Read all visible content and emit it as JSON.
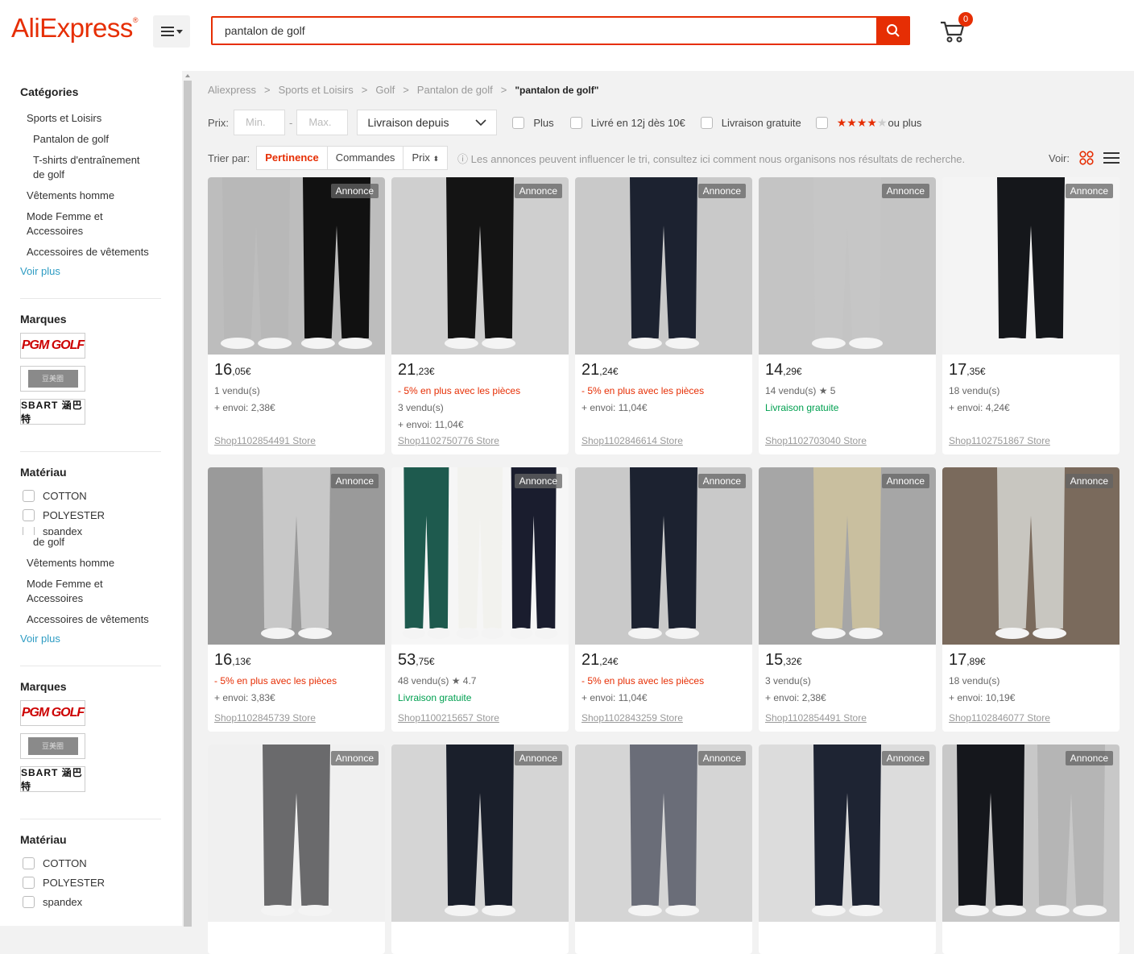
{
  "header": {
    "logo": "AliExpress",
    "logo_mark": "®",
    "search_value": "pantalon de golf",
    "cart_count": "0"
  },
  "sidebar": {
    "categories_title": "Catégories",
    "categories": [
      "Sports et Loisirs",
      "Pantalon de golf",
      "T-shirts d'entraînement de golf",
      "Vêtements homme",
      "Mode Femme et Accessoires",
      "Accessoires de vêtements"
    ],
    "categories_repeat": [
      "de golf",
      "Vêtements homme",
      "Mode Femme et Accessoires",
      "Accessoires de vêtements"
    ],
    "more": "Voir plus",
    "brands_title": "Marques",
    "brands": [
      "PGM GOLF",
      "豆美圈",
      "SBART 涵巴特"
    ],
    "material_title": "Matériau",
    "materials": [
      "COTTON",
      "POLYESTER",
      "spandex"
    ]
  },
  "breadcrumb": [
    "Aliexpress",
    "Sports et Loisirs",
    "Golf",
    "Pantalon de golf",
    "\"pantalon de golf\""
  ],
  "filters": {
    "price_label": "Prix:",
    "min_placeholder": "Min.",
    "max_placeholder": "Max.",
    "shipping_select": "Livraison depuis",
    "options": [
      "Plus",
      "Livré en 12j dès 10€",
      "Livraison gratuite",
      "ou plus"
    ],
    "rating_stars": 4
  },
  "sort": {
    "label": "Trier par:",
    "options": [
      "Pertinence",
      "Commandes",
      "Prix"
    ],
    "active": "Pertinence",
    "notice": "Les annonces peuvent influencer le tri, consultez ici comment nous organisons nos résultats de recherche.",
    "view_label": "Voir:"
  },
  "ad_label": "Annonce",
  "products": [
    {
      "price_int": "16",
      "price_dec": ",05€",
      "lines": [
        {
          "t": "1 vendu(s)",
          "c": ""
        },
        {
          "t": "+ envoi: 2,38€",
          "c": ""
        }
      ],
      "store": "Shop1102854491 Store",
      "tone": "#bdbdbd",
      "pants": [
        "#b8b8b8",
        "#111111"
      ]
    },
    {
      "price_int": "21",
      "price_dec": ",23€",
      "lines": [
        {
          "t": "- 5% en plus avec les pièces",
          "c": "red"
        },
        {
          "t": "3 vendu(s)",
          "c": ""
        },
        {
          "t": "+ envoi: 11,04€",
          "c": ""
        }
      ],
      "store": "Shop1102750776 Store",
      "tone": "#cfcfcf",
      "pants": [
        "#141414"
      ]
    },
    {
      "price_int": "21",
      "price_dec": ",24€",
      "lines": [
        {
          "t": "- 5% en plus avec les pièces",
          "c": "red"
        },
        {
          "t": "+ envoi: 11,04€",
          "c": ""
        }
      ],
      "store": "Shop1102846614 Store",
      "tone": "#c9c9c9",
      "pants": [
        "#1c2230"
      ]
    },
    {
      "price_int": "14",
      "price_dec": ",29€",
      "lines": [
        {
          "t": "14 vendu(s) ★ 5",
          "c": ""
        },
        {
          "t": "Livraison gratuite",
          "c": "green"
        }
      ],
      "store": "Shop1102703040 Store",
      "tone": "#c4c4c4",
      "pants": [
        "#c6c6c6"
      ]
    },
    {
      "price_int": "17",
      "price_dec": ",35€",
      "lines": [
        {
          "t": "18 vendu(s)",
          "c": ""
        },
        {
          "t": "+ envoi: 4,24€",
          "c": ""
        }
      ],
      "store": "Shop1102751867 Store",
      "tone": "#f4f4f4",
      "pants": [
        "#15171b"
      ]
    },
    {
      "price_int": "16",
      "price_dec": ",13€",
      "lines": [
        {
          "t": "- 5% en plus avec les pièces",
          "c": "red"
        },
        {
          "t": "+ envoi: 3,83€",
          "c": ""
        }
      ],
      "store": "Shop1102845739 Store",
      "tone": "#9a9a9a",
      "pants": [
        "#c8c8c8"
      ]
    },
    {
      "price_int": "53",
      "price_dec": ",75€",
      "lines": [
        {
          "t": "48 vendu(s) ★ 4.7",
          "c": ""
        },
        {
          "t": "Livraison gratuite",
          "c": "green"
        }
      ],
      "store": "Shop1100215657 Store",
      "tone": "#f6f6f6",
      "pants": [
        "#1e5a4e",
        "#f2f2ee",
        "#1a1d2e"
      ]
    },
    {
      "price_int": "21",
      "price_dec": ",24€",
      "lines": [
        {
          "t": "- 5% en plus avec les pièces",
          "c": "red"
        },
        {
          "t": "+ envoi: 11,04€",
          "c": ""
        }
      ],
      "store": "Shop1102843259 Store",
      "tone": "#c9c9c9",
      "pants": [
        "#1c2230"
      ]
    },
    {
      "price_int": "15",
      "price_dec": ",32€",
      "lines": [
        {
          "t": "3 vendu(s)",
          "c": ""
        },
        {
          "t": "+ envoi: 2,38€",
          "c": ""
        }
      ],
      "store": "Shop1102854491 Store",
      "tone": "#a6a6a6",
      "pants": [
        "#c9bf9f"
      ]
    },
    {
      "price_int": "17",
      "price_dec": ",89€",
      "lines": [
        {
          "t": "18 vendu(s)",
          "c": ""
        },
        {
          "t": "+ envoi: 10,19€",
          "c": ""
        }
      ],
      "store": "Shop1102846077 Store",
      "tone": "#7a6a5c",
      "pants": [
        "#c8c6c0"
      ]
    },
    {
      "price_int": "",
      "price_dec": "",
      "lines": [],
      "store": "",
      "tone": "#f0f0f0",
      "pants": [
        "#6a6a6c"
      ]
    },
    {
      "price_int": "",
      "price_dec": "",
      "lines": [],
      "store": "",
      "tone": "#d5d5d5",
      "pants": [
        "#1a1f2b"
      ]
    },
    {
      "price_int": "",
      "price_dec": "",
      "lines": [],
      "store": "",
      "tone": "#d5d5d5",
      "pants": [
        "#6a6d78"
      ]
    },
    {
      "price_int": "",
      "price_dec": "",
      "lines": [],
      "store": "",
      "tone": "#dcdcdc",
      "pants": [
        "#1e2433"
      ]
    },
    {
      "price_int": "",
      "price_dec": "",
      "lines": [],
      "store": "",
      "tone": "#c8c8c8",
      "pants": [
        "#15171c",
        "#b5b5b5"
      ]
    }
  ]
}
